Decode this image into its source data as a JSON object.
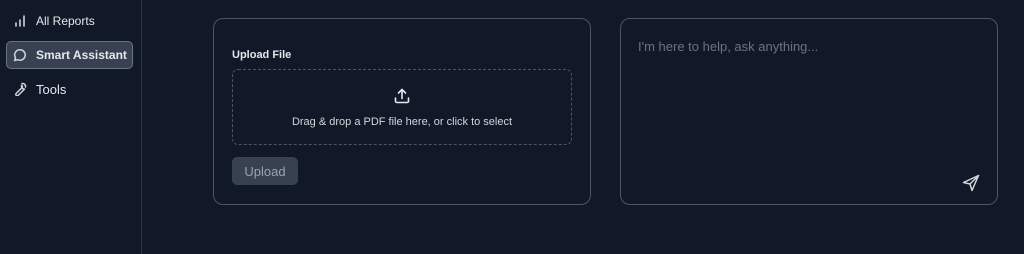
{
  "sidebar": {
    "items": [
      {
        "label": "All Reports",
        "icon": "bar-chart-icon"
      },
      {
        "label": "Smart Assistant",
        "icon": "chat-bubble-icon",
        "active": true
      },
      {
        "label": "Tools",
        "icon": "wrench-icon"
      }
    ]
  },
  "upload": {
    "title": "Upload File",
    "dropzone_text": "Drag & drop a PDF file here, or click to select",
    "upload_label": "Upload",
    "icon": "upload-icon"
  },
  "chat": {
    "placeholder": "I'm here to help, ask anything...",
    "send_icon": "send-icon"
  },
  "colors": {
    "background": "#111827",
    "border": "#4b5563",
    "active_nav_bg": "#374151",
    "text": "#e5e7eb",
    "muted_text": "#6b7280"
  }
}
